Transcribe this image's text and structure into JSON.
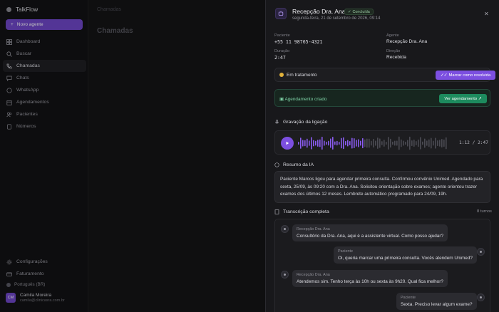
{
  "sidebar": {
    "brand": "TalkFlow",
    "new_button": "Novo agente",
    "items": [
      {
        "label": "Dashboard",
        "icon": "grid-icon"
      },
      {
        "label": "Buscar",
        "icon": "search-icon"
      },
      {
        "label": "Chamadas",
        "icon": "phone-icon"
      },
      {
        "label": "Chats",
        "icon": "chat-icon"
      },
      {
        "label": "WhatsApp",
        "icon": "whatsapp-icon"
      },
      {
        "label": "Agendamentos",
        "icon": "calendar-icon"
      },
      {
        "label": "Pacientes",
        "icon": "users-icon"
      },
      {
        "label": "Números",
        "icon": "hash-icon"
      }
    ],
    "active_index": 2,
    "bottom_items": [
      {
        "label": "Configurações",
        "icon": "gear-icon"
      },
      {
        "label": "Faturamento",
        "icon": "card-icon"
      }
    ],
    "language": "Português (BR)",
    "user": {
      "initials": "CM",
      "name": "Camila Moreira",
      "email": "camila@clinicasra.com.br"
    }
  },
  "main": {
    "breadcrumb": "Chamadas",
    "title": "Chamadas"
  },
  "panel": {
    "title": "Recepção Dra. Ana",
    "badge": "Concluída",
    "subtitle": "segunda-feira, 21 de setembro de 2026, 09:14",
    "fields": {
      "paciente_label": "Paciente",
      "paciente_value": "+55 11 98765-4321",
      "agente_label": "Agente",
      "agente_value": "Recepção Dra. Ana",
      "duracao_label": "Duração",
      "duracao_value": "2:47",
      "direcao_label": "Direção",
      "direcao_value": "Recebida"
    },
    "status": {
      "text": "Em tratamento",
      "button": "Marcar como resolvida",
      "color": "#e0b13a"
    },
    "schedule": {
      "text": "Agendamento criado",
      "button": "Ver agendamento ↗"
    },
    "recording": {
      "title": "Gravação da ligação",
      "time": "1:12 / 2:47",
      "progress": 0.43
    },
    "summary": {
      "title": "Resumo da IA",
      "text": "Paciente Marcos ligou para agendar primeira consulta. Confirmou convênio Unimed. Agendado para sexta, 25/09, às 09:20 com a Dra. Ana. Solicitou orientação sobre exames; agente orientou trazer exames dos últimos 12 meses. Lembrete automático programado para 24/09, 19h."
    },
    "transcript": {
      "title": "Transcrição completa",
      "turns": "8 turnos",
      "messages": [
        {
          "speaker": "Recepção Dra. Ana",
          "text": "Consultório da Dra. Ana, aqui é a assistente virtual. Como posso ajudar?",
          "side": "left"
        },
        {
          "speaker": "Paciente",
          "text": "Oi, queria marcar uma primeira consulta. Vocês atendem Unimed?",
          "side": "right"
        },
        {
          "speaker": "Recepção Dra. Ana",
          "text": "Atendemos sim. Tenho terça às 10h ou sexta às 9h20. Qual fica melhor?",
          "side": "left"
        },
        {
          "speaker": "Paciente",
          "text": "Sexta. Preciso levar algum exame?",
          "side": "right"
        }
      ]
    }
  }
}
